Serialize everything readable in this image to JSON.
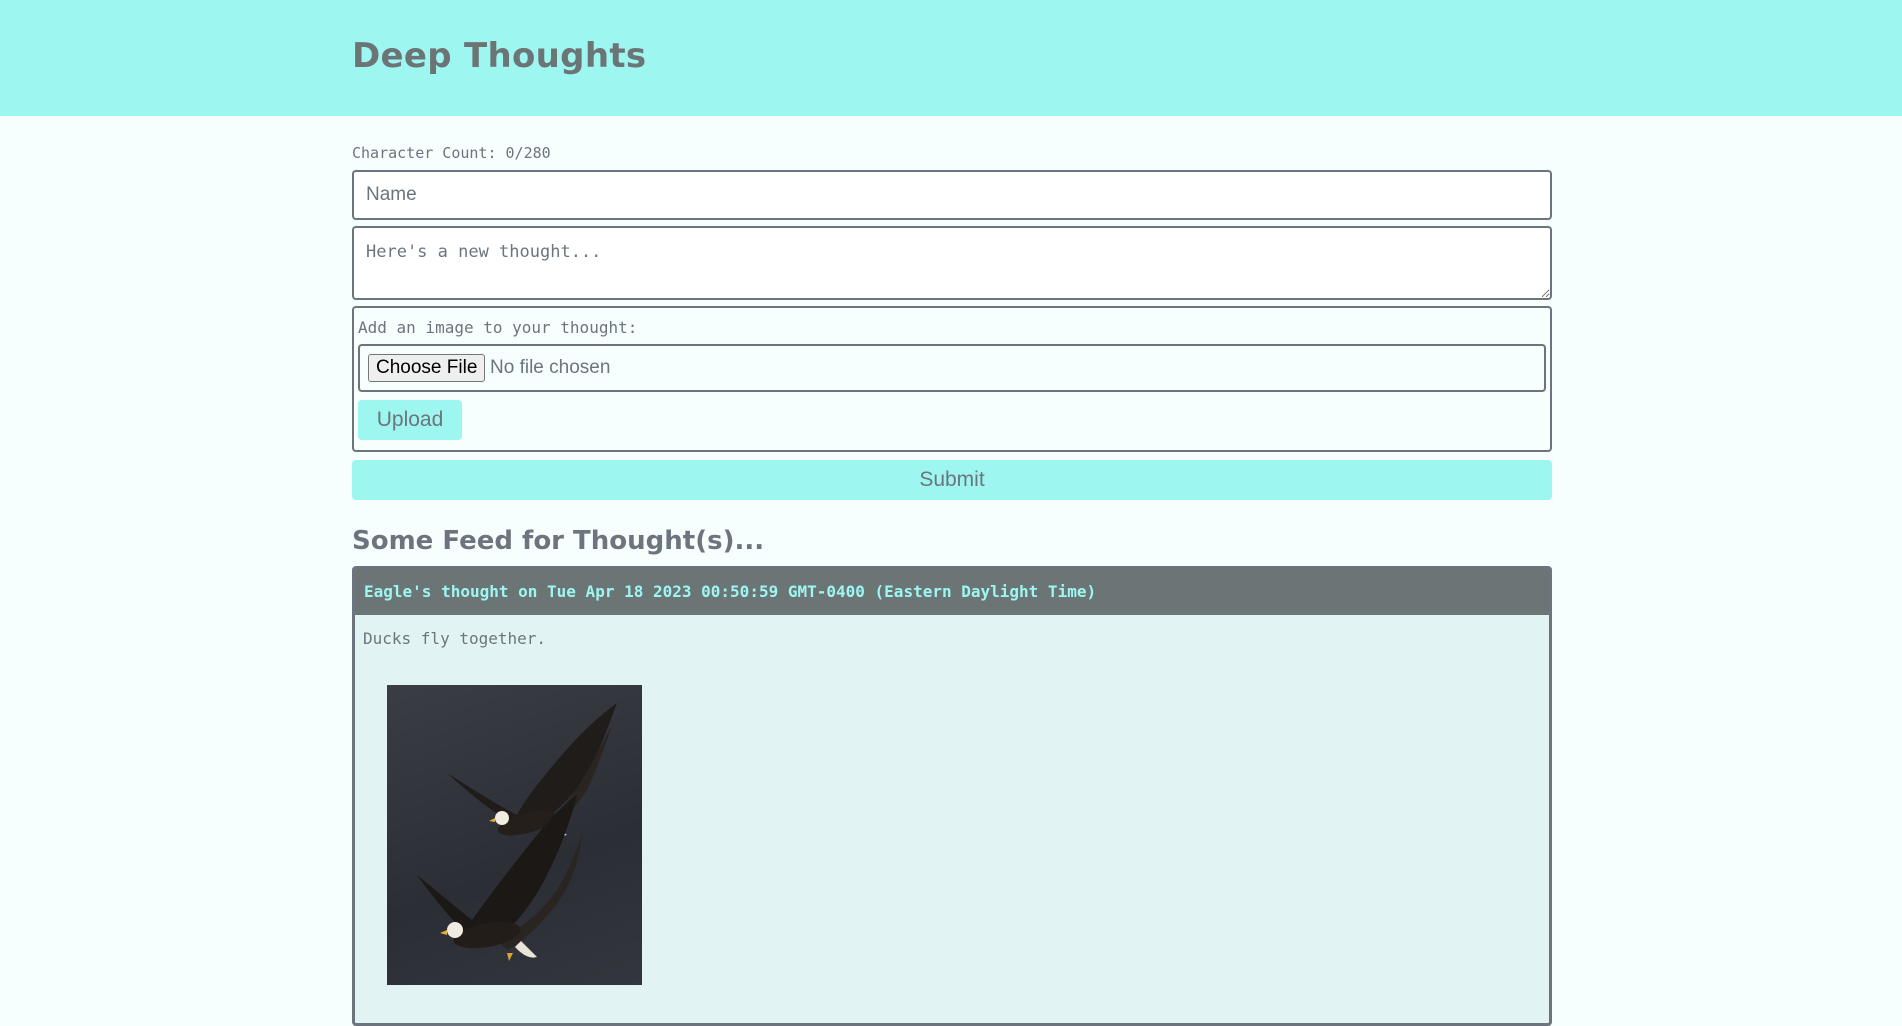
{
  "header": {
    "title": "Deep Thoughts"
  },
  "form": {
    "character_count": "Character Count: 0/280",
    "name_placeholder": "Name",
    "name_value": "",
    "thought_placeholder": "Here's a new thought...",
    "thought_value": "",
    "image_label": "Add an image to your thought:",
    "choose_file_label": "Choose File",
    "no_file_text": "No file chosen",
    "upload_label": "Upload",
    "submit_label": "Submit"
  },
  "feed": {
    "title": "Some Feed for Thought(s)...",
    "thoughts": [
      {
        "header": "Eagle's thought on Tue Apr 18 2023 00:50:59 GMT-0400 (Eastern Daylight Time)",
        "body": "Ducks fly together.",
        "image_icon": "bald-eagles-in-flight-photo"
      }
    ]
  },
  "colors": {
    "accent": "#9ef6f1",
    "header_dark": "#6c7576",
    "page_bg": "#f5fffd",
    "card_bg": "#e1f4f3",
    "text": "#6c757d"
  }
}
